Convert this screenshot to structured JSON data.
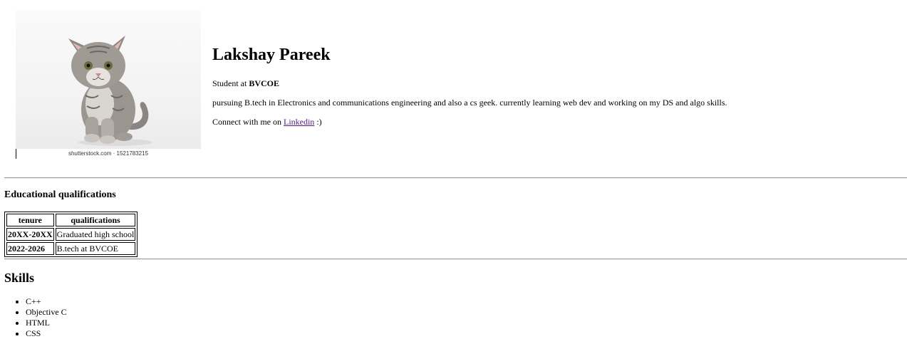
{
  "profile": {
    "image_caption": "shutterstock.com · 1521783215",
    "name": "Lakshay Pareek",
    "student_prefix": "Student at ",
    "college": "BVCOE",
    "description": "pursuing B.tech in Electronics and communications engineering and also a cs geek. currently learning web dev and working on my DS and algo skills.",
    "connect_prefix": "Connect with me on ",
    "connect_link_label": "Linkedin",
    "connect_suffix": " :)"
  },
  "education": {
    "heading": "Educational qualifications",
    "columns": [
      "tenure",
      "qualifications"
    ],
    "rows": [
      {
        "tenure": "20XX-20XX",
        "qualification": "Graduated high school"
      },
      {
        "tenure": "2022-2026",
        "qualification": "B.tech at BVCOE"
      }
    ]
  },
  "skills": {
    "heading": "Skills",
    "items": [
      "C++",
      "Objective C",
      "HTML",
      "CSS"
    ]
  }
}
